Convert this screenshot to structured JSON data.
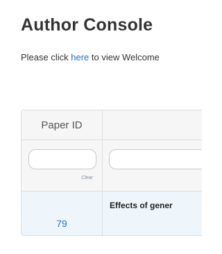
{
  "page": {
    "title": "Author Console",
    "welcome": {
      "prefix": "Please click ",
      "link_text": "here",
      "suffix": " to view Welcome"
    }
  },
  "table": {
    "columns": [
      {
        "label": "Paper ID"
      },
      {
        "label": ""
      }
    ],
    "filters": {
      "paper_id_value": "",
      "title_value": "",
      "clear_label": "Clear"
    },
    "rows": [
      {
        "paper_id": "79",
        "title": "Effects of gener"
      }
    ]
  },
  "colors": {
    "link": "#1f74c4",
    "row_highlight": "#eef6fb",
    "header_bg": "#f6f6f6",
    "border": "#dddddd"
  }
}
